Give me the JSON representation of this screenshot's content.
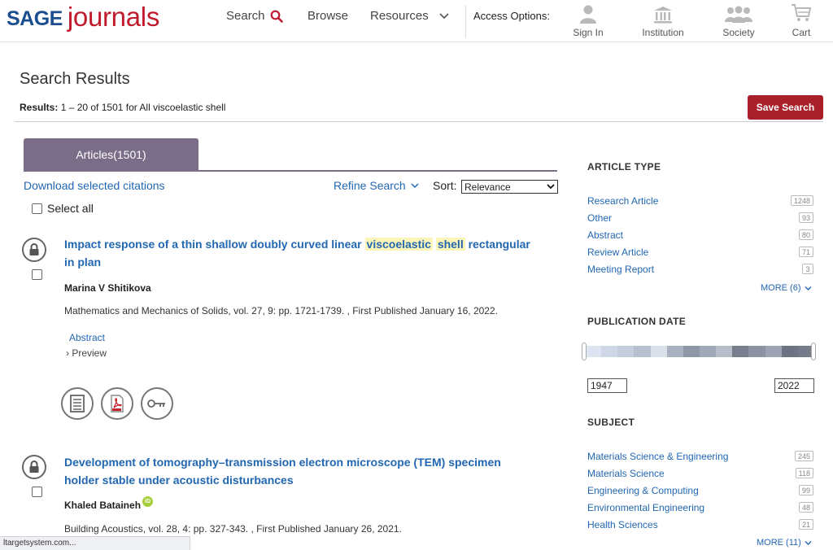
{
  "header": {
    "logo_sage": "SAGE",
    "logo_journals": "journals",
    "nav": {
      "search": "Search",
      "browse": "Browse",
      "resources": "Resources"
    },
    "access_options": "Access Options:",
    "buttons": {
      "sign_in": "Sign In",
      "institution": "Institution",
      "society": "Society",
      "cart": "Cart"
    }
  },
  "page": {
    "title": "Search Results",
    "results_prefix": "Results:",
    "results_text": "1 – 20 of 1501 for All viscoelastic shell",
    "save_search": "Save Search"
  },
  "tabs": {
    "articles": "Articles(1501)"
  },
  "toolbar": {
    "download_citations": "Download selected citations",
    "refine_search": "Refine Search",
    "sort_label": "Sort:",
    "sort_value": "Relevance",
    "select_all": "Select all"
  },
  "results": [
    {
      "title_pre": "Impact response of a thin shallow doubly curved linear",
      "title_hl1": "viscoelastic",
      "title_hl2": "shell",
      "title_post1": "rectangular",
      "title_post2": "in plan",
      "author": "Marina V Shitikova",
      "meta": "Mathematics and Mechanics of Solids, vol. 27, 9: pp. 1721-1739. , First Published January 16, 2022.",
      "abstract": "Abstract",
      "preview": "Preview"
    },
    {
      "title_line1": "Development of tomography–transmission electron microscope (TEM) specimen",
      "title_line2": "holder stable under acoustic disturbances",
      "author": "Khaled Bataineh",
      "orcid": "iD",
      "meta": "Building Acoustics, vol. 28, 4: pp. 327-343. , First Published January 26, 2021."
    }
  ],
  "sidebar": {
    "article_type": {
      "heading": "ARTICLE TYPE",
      "items": [
        {
          "label": "Research Article",
          "count": "1248"
        },
        {
          "label": "Other",
          "count": "93"
        },
        {
          "label": "Abstract",
          "count": "80"
        },
        {
          "label": "Review Article",
          "count": "71"
        },
        {
          "label": "Meeting Report",
          "count": "3"
        }
      ],
      "more": "MORE (6)"
    },
    "publication_date": {
      "heading": "PUBLICATION DATE",
      "from": "1947",
      "to": "2022"
    },
    "subject": {
      "heading": "SUBJECT",
      "items": [
        {
          "label": "Materials Science & Engineering",
          "count": "245"
        },
        {
          "label": "Materials Science",
          "count": "118"
        },
        {
          "label": "Engineering & Computing",
          "count": "99"
        },
        {
          "label": "Environmental Engineering",
          "count": "48"
        },
        {
          "label": "Health Sciences",
          "count": "21"
        }
      ],
      "more": "MORE (11)"
    }
  },
  "status_bar": "ltargetsystem.com...",
  "colors": {
    "brand_red": "#a91f2a",
    "link_blue": "#2267b2",
    "tab_purple": "#7a6d88",
    "highlight": "#fbf6b8"
  }
}
